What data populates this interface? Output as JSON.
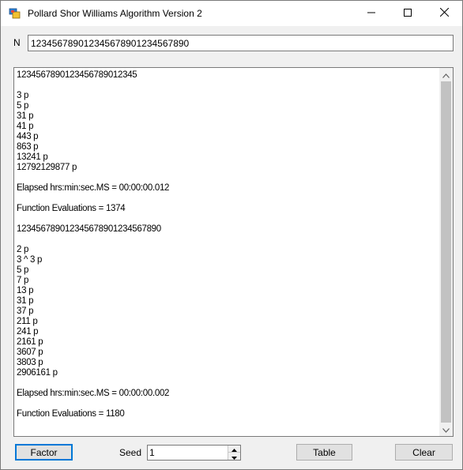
{
  "window": {
    "title": "Pollard Shor Williams Algorithm Version 2",
    "app_icon": "app-icon"
  },
  "titlebar_buttons": {
    "minimize_icon": "minimize-icon",
    "maximize_icon": "maximize-icon",
    "close_icon": "close-icon"
  },
  "n_field": {
    "label": "N",
    "value": "12345678901234567890123456789­0"
  },
  "output": {
    "lines": [
      "1234567890123456789012345",
      "",
      "3 p",
      "5 p",
      "31 p",
      "41 p",
      "443 p",
      "863 p",
      "13241 p",
      "12792129877 p",
      "",
      "Elapsed hrs:min:sec.MS = 00:00:00.012",
      "",
      "Function Evaluations = 1374",
      "",
      "123456789012345678901234567890",
      "",
      "2 p",
      "3 ^ 3 p",
      "5 p",
      "7 p",
      "13 p",
      "31 p",
      "37 p",
      "211 p",
      "241 p",
      "2161 p",
      "3607 p",
      "3803 p",
      "2906161 p",
      "",
      "Elapsed hrs:min:sec.MS = 00:00:00.002",
      "",
      "Function Evaluations = 1180"
    ]
  },
  "controls": {
    "factor_label": "Factor",
    "seed_label": "Seed",
    "seed_value": "1",
    "table_label": "Table",
    "clear_label": "Clear"
  },
  "colors": {
    "focus_border": "#0078d7",
    "window_bg": "#f0f0f0"
  }
}
